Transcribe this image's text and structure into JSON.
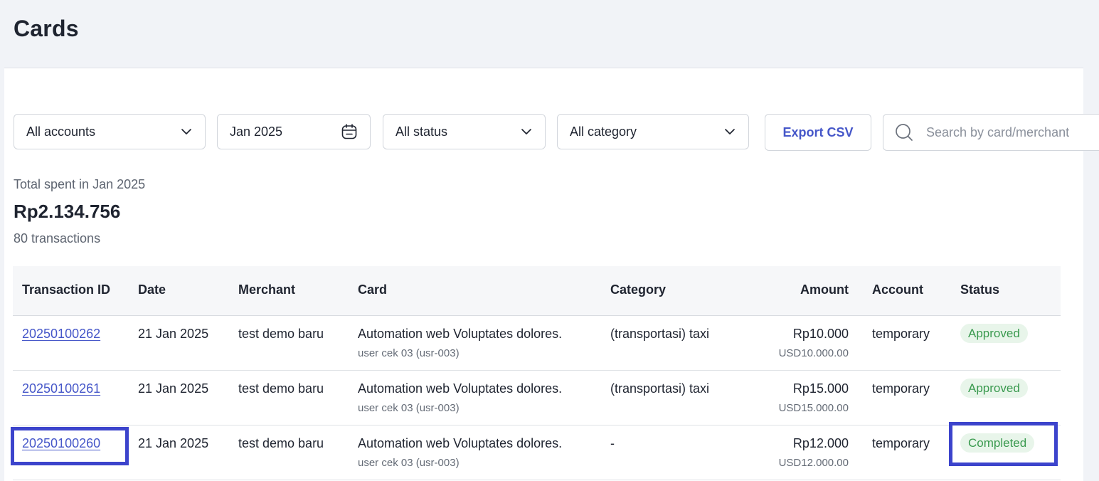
{
  "page": {
    "title": "Cards"
  },
  "filters": {
    "accounts": "All accounts",
    "date": "Jan 2025",
    "status": "All status",
    "category": "All category",
    "export_label": "Export CSV",
    "search_placeholder": "Search by card/merchant"
  },
  "summary": {
    "label": "Total spent in Jan 2025",
    "total": "Rp2.134.756",
    "count": "80 transactions"
  },
  "table": {
    "columns": [
      "Transaction ID",
      "Date",
      "Merchant",
      "Card",
      "Category",
      "Amount",
      "Account",
      "Status"
    ],
    "rows": [
      {
        "id": "20250100262",
        "date": "21 Jan 2025",
        "merchant": "test demo baru",
        "card": "Automation web Voluptates dolores.",
        "card_user": "user cek 03 (usr-003)",
        "category": "(transportasi) taxi",
        "amount": "Rp10.000",
        "amount_usd": "USD10.000.00",
        "account": "temporary",
        "status": "Approved"
      },
      {
        "id": "20250100261",
        "date": "21 Jan 2025",
        "merchant": "test demo baru",
        "card": "Automation web Voluptates dolores.",
        "card_user": "user cek 03 (usr-003)",
        "category": "(transportasi) taxi",
        "amount": "Rp15.000",
        "amount_usd": "USD15.000.00",
        "account": "temporary",
        "status": "Approved"
      },
      {
        "id": "20250100260",
        "date": "21 Jan 2025",
        "merchant": "test demo baru",
        "card": "Automation web Voluptates dolores.",
        "card_user": "user cek 03 (usr-003)",
        "category": "-",
        "amount": "Rp12.000",
        "amount_usd": "USD12.000.00",
        "account": "temporary",
        "status": "Completed"
      }
    ]
  },
  "colors": {
    "accent": "#4657c9",
    "highlight": "#3c44cc",
    "status_green": "#3a9a4f",
    "status_green_bg": "#e8f5ea",
    "page_bg": "#f1f3f7"
  },
  "icons": {
    "dropdown": "chevron-down-icon",
    "date": "calendar-icon",
    "search": "search-icon"
  }
}
